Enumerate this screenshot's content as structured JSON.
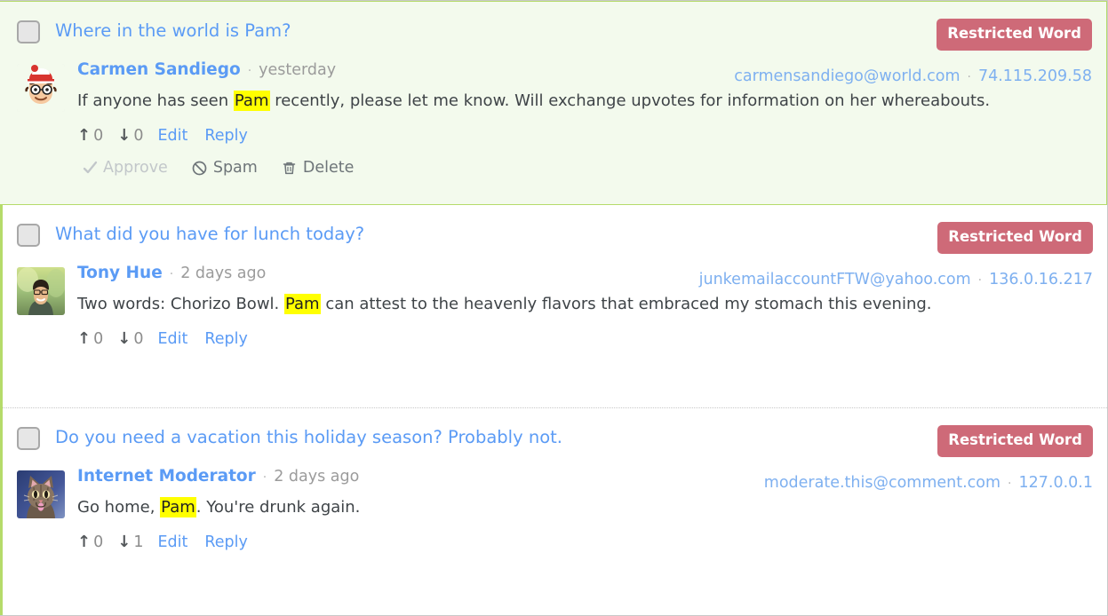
{
  "theme": {
    "accent_green": "#b5db6a",
    "selected_row_bg": "#f3faed",
    "badge_red": "#ce6a78",
    "link_blue": "#5b9bf5",
    "highlight_yellow": "#ffff00"
  },
  "rows": [
    {
      "post_title": "Where in the world is Pam?",
      "badge": "Restricted Word",
      "checkbox_checked": false,
      "selected": true,
      "avatar_icon": "waldo-avatar",
      "author": "Carmen Sandiego",
      "separator": "·",
      "timestamp": "yesterday",
      "email": "carmensandiego@world.com",
      "ip": "74.115.209.58",
      "text_before": "If anyone has seen ",
      "highlight": "Pam",
      "text_after": " recently, please let me know. Will exchange upvotes for information on her whereabouts.",
      "upvote_icon": "arrow-up-icon",
      "upvotes": "0",
      "downvote_icon": "arrow-down-icon",
      "downvotes": "0",
      "edit_label": "Edit",
      "reply_label": "Reply",
      "has_moderation": true,
      "approve_label": "Approve",
      "approve_icon": "check-icon",
      "spam_label": "Spam",
      "spam_icon": "ban-icon",
      "delete_label": "Delete",
      "delete_icon": "trash-icon"
    },
    {
      "post_title": "What did you have for lunch today?",
      "badge": "Restricted Word",
      "checkbox_checked": false,
      "selected": false,
      "avatar_icon": "photo-portrait-avatar",
      "author": "Tony Hue",
      "separator": "·",
      "timestamp": "2 days ago",
      "email": "junkemailaccountFTW@yahoo.com",
      "ip": "136.0.16.217",
      "text_before": "Two words: Chorizo Bowl. ",
      "highlight": "Pam",
      "text_after": " can attest to the heavenly flavors that embraced my stomach this evening.",
      "upvote_icon": "arrow-up-icon",
      "upvotes": "0",
      "downvote_icon": "arrow-down-icon",
      "downvotes": "0",
      "edit_label": "Edit",
      "reply_label": "Reply",
      "has_moderation": false
    },
    {
      "post_title": "Do you need a vacation this holiday season? Probably not.",
      "badge": "Restricted Word",
      "checkbox_checked": false,
      "selected": false,
      "avatar_icon": "cat-photo-avatar",
      "author": "Internet Moderator",
      "separator": "·",
      "timestamp": "2 days ago",
      "email": "moderate.this@comment.com",
      "ip": "127.0.0.1",
      "text_before": "Go home, ",
      "highlight": "Pam",
      "text_after": ". You're drunk again.",
      "upvote_icon": "arrow-up-icon",
      "upvotes": "0",
      "downvote_icon": "arrow-down-icon",
      "downvotes": "1",
      "edit_label": "Edit",
      "reply_label": "Reply",
      "has_moderation": false
    }
  ]
}
